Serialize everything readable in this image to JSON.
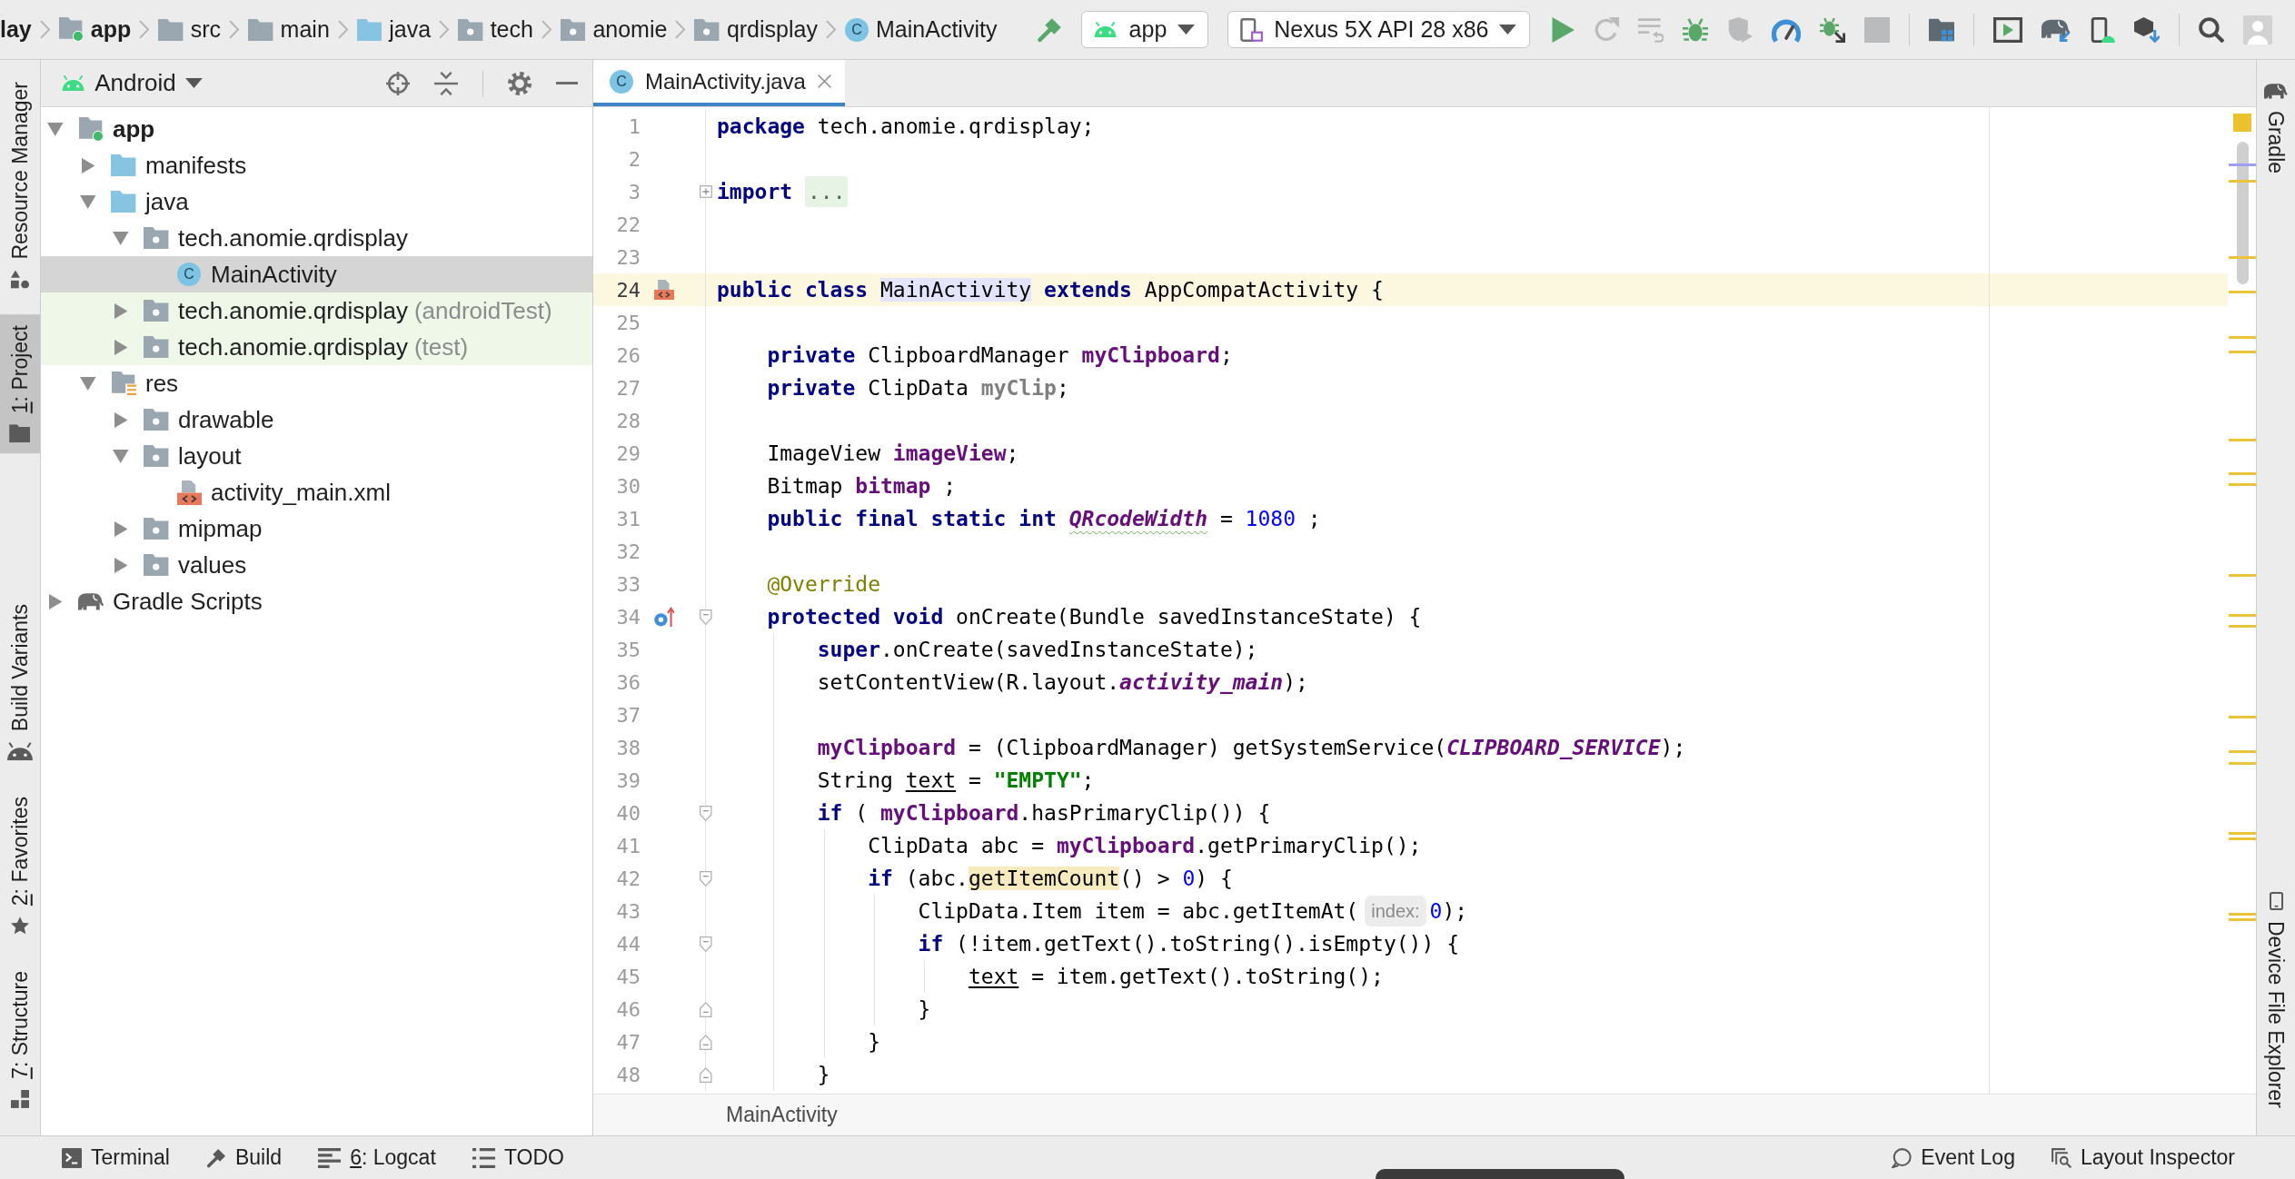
{
  "breadcrumb": [
    {
      "label": "lay",
      "kind": "project"
    },
    {
      "label": "app",
      "kind": "module"
    },
    {
      "label": "src",
      "kind": "folder"
    },
    {
      "label": "main",
      "kind": "folder"
    },
    {
      "label": "java",
      "kind": "source-folder"
    },
    {
      "label": "tech",
      "kind": "package"
    },
    {
      "label": "anomie",
      "kind": "package"
    },
    {
      "label": "qrdisplay",
      "kind": "package"
    },
    {
      "label": "MainActivity",
      "kind": "class",
      "icon_letter": "C"
    }
  ],
  "toolbar": {
    "actions": [
      {
        "kind": "hammer",
        "disabled": false
      },
      {
        "kind": "config-dropdown",
        "label": "app",
        "disabled": false
      },
      {
        "kind": "device-dropdown",
        "label": "Nexus 5X API 28 x86",
        "disabled": false
      },
      {
        "kind": "play",
        "disabled": false
      },
      {
        "kind": "refresh-arrow",
        "disabled": true
      },
      {
        "kind": "lines-arrow",
        "disabled": true
      },
      {
        "kind": "bug",
        "disabled": false
      },
      {
        "kind": "shield-play",
        "disabled": true
      },
      {
        "kind": "gauge",
        "disabled": false
      },
      {
        "kind": "bug-arrow",
        "disabled": false
      },
      {
        "kind": "stop",
        "disabled": true
      },
      {
        "kind": "separator"
      },
      {
        "kind": "folder-grid",
        "disabled": false
      },
      {
        "kind": "separator"
      },
      {
        "kind": "screen-play",
        "disabled": false
      },
      {
        "kind": "elephant-arrow",
        "disabled": false
      },
      {
        "kind": "phone-android",
        "disabled": false
      },
      {
        "kind": "box-arrow",
        "disabled": false
      },
      {
        "kind": "separator"
      },
      {
        "kind": "search",
        "disabled": false
      },
      {
        "kind": "avatar",
        "disabled": false
      }
    ]
  },
  "left_strip": {
    "top": [
      {
        "label": "Resource Manager",
        "kind": "shapes",
        "mnemonic": false,
        "selected": false
      },
      {
        "label": "1: Project",
        "kind": "folder",
        "mnemonic": true,
        "selected": true
      }
    ],
    "bottom": [
      {
        "label": "Build Variants",
        "kind": "android",
        "mnemonic": false,
        "selected": false
      },
      {
        "label": "2: Favorites",
        "kind": "star",
        "mnemonic": true,
        "selected": false
      },
      {
        "label": "7: Structure",
        "kind": "structure",
        "mnemonic": true,
        "selected": false
      }
    ]
  },
  "project_panel": {
    "view": "Android",
    "tools": [
      {
        "kind": "crosshair"
      },
      {
        "kind": "collapse"
      },
      {
        "kind": "separator"
      },
      {
        "kind": "gear"
      },
      {
        "kind": "minimize"
      }
    ],
    "tree": [
      {
        "label": "app",
        "kind": "module",
        "expanded": true,
        "selected": false,
        "test_source": false,
        "children": [
          {
            "label": "manifests",
            "kind": "source-folder",
            "expanded": false,
            "selected": false,
            "test_source": false
          },
          {
            "label": "java",
            "kind": "source-folder",
            "expanded": true,
            "selected": false,
            "test_source": false,
            "children": [
              {
                "label": "tech.anomie.qrdisplay",
                "kind": "package",
                "expanded": true,
                "selected": false,
                "test_source": false,
                "children": [
                  {
                    "label": "MainActivity",
                    "kind": "class",
                    "icon_letter": "C",
                    "selected": true,
                    "test_source": false
                  }
                ]
              },
              {
                "label": "tech.anomie.qrdisplay",
                "suffix": "(androidTest)",
                "kind": "package",
                "expanded": false,
                "selected": false,
                "test_source": true
              },
              {
                "label": "tech.anomie.qrdisplay",
                "suffix": "(test)",
                "kind": "package",
                "expanded": false,
                "selected": false,
                "test_source": true
              }
            ]
          },
          {
            "label": "res",
            "kind": "res-folder",
            "expanded": true,
            "selected": false,
            "test_source": false,
            "children": [
              {
                "label": "drawable",
                "kind": "package",
                "expanded": false,
                "selected": false,
                "test_source": false
              },
              {
                "label": "layout",
                "kind": "package",
                "expanded": true,
                "selected": false,
                "test_source": false,
                "children": [
                  {
                    "label": "activity_main.xml",
                    "kind": "xml",
                    "selected": false,
                    "test_source": false
                  }
                ]
              },
              {
                "label": "mipmap",
                "kind": "package",
                "expanded": false,
                "selected": false,
                "test_source": false
              },
              {
                "label": "values",
                "kind": "package",
                "expanded": false,
                "selected": false,
                "test_source": false
              }
            ]
          }
        ]
      },
      {
        "label": "Gradle Scripts",
        "kind": "gradle",
        "expanded": false,
        "selected": false,
        "test_source": false
      }
    ]
  },
  "editor": {
    "tabs": [
      {
        "label": "MainActivity.java",
        "icon_letter": "C",
        "selected": true
      }
    ],
    "lines": [
      {
        "number": "1",
        "current": false,
        "tokens": [
          {
            "text": "package",
            "kind": "keyword"
          },
          {
            "text": " tech.anomie.qrdisplay;"
          }
        ]
      },
      {
        "number": "2",
        "current": false
      },
      {
        "number": "3",
        "current": false,
        "gutter": [
          {
            "kind": "fold-collapsed"
          }
        ],
        "tokens": [
          {
            "text": "import",
            "kind": "keyword"
          },
          {
            "text": "...",
            "kind": "fold"
          }
        ]
      },
      {
        "number": "22",
        "current": false
      },
      {
        "number": "23",
        "current": false
      },
      {
        "number": "24",
        "current": true,
        "gutter": [
          {
            "kind": "layout-marker"
          }
        ],
        "tokens": [
          {
            "text": "public class ",
            "kind": "keyword"
          },
          {
            "text": "MainActivity",
            "kind": "usage"
          },
          {
            "text": " extends",
            "kind": "keyword"
          },
          {
            "text": " AppCompatActivity {"
          }
        ]
      },
      {
        "number": "25",
        "current": false
      },
      {
        "number": "26",
        "current": false,
        "tokens": [
          {
            "text": "    private",
            "kind": "keyword"
          },
          {
            "text": " ClipboardManager "
          },
          {
            "text": "myClipboard",
            "kind": "field"
          },
          {
            "text": ";"
          }
        ]
      },
      {
        "number": "27",
        "current": false,
        "tokens": [
          {
            "text": "    private",
            "kind": "keyword"
          },
          {
            "text": " ClipData "
          },
          {
            "text": "myClip",
            "kind": "unused-field"
          },
          {
            "text": ";"
          }
        ]
      },
      {
        "number": "28",
        "current": false
      },
      {
        "number": "29",
        "current": false,
        "tokens": [
          {
            "text": "    ImageView "
          },
          {
            "text": "imageView",
            "kind": "field"
          },
          {
            "text": ";"
          }
        ]
      },
      {
        "number": "30",
        "current": false,
        "tokens": [
          {
            "text": "    Bitmap "
          },
          {
            "text": "bitmap",
            "kind": "field"
          },
          {
            "text": " ;"
          }
        ]
      },
      {
        "number": "31",
        "current": false,
        "tokens": [
          {
            "text": "    public final static int ",
            "kind": "keyword"
          },
          {
            "text": "QRcodeWidth",
            "kind": "static-field-typo"
          },
          {
            "text": " = "
          },
          {
            "text": "1080",
            "kind": "number"
          },
          {
            "text": " ;"
          }
        ]
      },
      {
        "number": "32",
        "current": false
      },
      {
        "number": "33",
        "current": false,
        "tokens": [
          {
            "text": "    @Override",
            "kind": "annotation"
          }
        ]
      },
      {
        "number": "34",
        "current": false,
        "gutter": [
          {
            "kind": "override-marker"
          },
          {
            "kind": "fold-start"
          }
        ],
        "tokens": [
          {
            "text": "    protected void",
            "kind": "keyword"
          },
          {
            "text": " onCreate(Bundle savedInstanceState) {"
          }
        ]
      },
      {
        "number": "35",
        "current": false,
        "tokens": [
          {
            "text": "        super",
            "kind": "keyword"
          },
          {
            "text": ".onCreate(savedInstanceState);"
          }
        ]
      },
      {
        "number": "36",
        "current": false,
        "tokens": [
          {
            "text": "        setContentView(R.layout."
          },
          {
            "text": "activity_main",
            "kind": "static-field"
          },
          {
            "text": ");"
          }
        ]
      },
      {
        "number": "37",
        "current": false
      },
      {
        "number": "38",
        "current": false,
        "tokens": [
          {
            "text": "        myClipboard",
            "kind": "field"
          },
          {
            "text": " = (ClipboardManager) getSystemService("
          },
          {
            "text": "CLIPBOARD_SERVICE",
            "kind": "static-field"
          },
          {
            "text": ");"
          }
        ]
      },
      {
        "number": "39",
        "current": false,
        "tokens": [
          {
            "text": "        String "
          },
          {
            "text": "text",
            "kind": "reassigned"
          },
          {
            "text": " = "
          },
          {
            "text": "\"EMPTY\"",
            "kind": "string"
          },
          {
            "text": ";"
          }
        ]
      },
      {
        "number": "40",
        "current": false,
        "gutter": [
          {
            "kind": "fold-start"
          }
        ],
        "tokens": [
          {
            "text": "        if",
            "kind": "keyword"
          },
          {
            "text": " ( "
          },
          {
            "text": "myClipboard",
            "kind": "field"
          },
          {
            "text": ".hasPrimaryClip()) {"
          }
        ]
      },
      {
        "number": "41",
        "current": false,
        "tokens": [
          {
            "text": "            ClipData abc = "
          },
          {
            "text": "myClipboard",
            "kind": "field"
          },
          {
            "text": ".getPrimaryClip();"
          }
        ]
      },
      {
        "number": "42",
        "current": false,
        "gutter": [
          {
            "kind": "fold-start"
          }
        ],
        "tokens": [
          {
            "text": "            if",
            "kind": "keyword"
          },
          {
            "text": " (abc."
          },
          {
            "text": "getItemCount",
            "kind": "highlight"
          },
          {
            "text": "() > "
          },
          {
            "text": "0",
            "kind": "number"
          },
          {
            "text": ") {"
          }
        ]
      },
      {
        "number": "43",
        "current": false,
        "tokens": [
          {
            "text": "                ClipData.Item item = abc.getItemAt("
          },
          {
            "text": "index:",
            "kind": "hint"
          },
          {
            "text": "0",
            "kind": "number"
          },
          {
            "text": ");"
          }
        ]
      },
      {
        "number": "44",
        "current": false,
        "gutter": [
          {
            "kind": "fold-start"
          }
        ],
        "tokens": [
          {
            "text": "                if",
            "kind": "keyword"
          },
          {
            "text": " (!item.getText().toString().isEmpty()) {"
          }
        ]
      },
      {
        "number": "45",
        "current": false,
        "tokens": [
          {
            "text": "                    text",
            "kind": "reassigned"
          },
          {
            "text": " = item.getText().toString();"
          }
        ]
      },
      {
        "number": "46",
        "current": false,
        "gutter": [
          {
            "kind": "fold-end"
          }
        ],
        "tokens": [
          {
            "text": "                }"
          }
        ]
      },
      {
        "number": "47",
        "current": false,
        "gutter": [
          {
            "kind": "fold-end"
          }
        ],
        "tokens": [
          {
            "text": "            }"
          }
        ]
      },
      {
        "number": "48",
        "current": false,
        "gutter": [
          {
            "kind": "fold-end"
          }
        ],
        "tokens": [
          {
            "text": "        }"
          }
        ]
      }
    ],
    "breadcrumb": [
      {
        "label": "MainActivity"
      }
    ]
  },
  "right_strip": {
    "top": [
      {
        "label": "Gradle",
        "kind": "elephant",
        "mnemonic": false,
        "selected": false
      }
    ],
    "bottom": [
      {
        "label": "Device File Explorer",
        "kind": "phone",
        "mnemonic": false,
        "selected": false
      }
    ]
  },
  "bottom_bar": {
    "left": [
      {
        "label": "Terminal",
        "kind": "terminal",
        "mnemonic": false,
        "selected": false
      },
      {
        "label": "Build",
        "kind": "hammer",
        "mnemonic": false,
        "selected": false
      },
      {
        "label": "6: Logcat",
        "kind": "lines",
        "mnemonic": true,
        "selected": false
      },
      {
        "label": "TODO",
        "kind": "list",
        "mnemonic": false,
        "selected": false
      }
    ],
    "right": [
      {
        "label": "Event Log",
        "kind": "bubble",
        "mnemonic": false,
        "selected": false
      },
      {
        "label": "Layout Inspector",
        "kind": "inspector",
        "mnemonic": false,
        "selected": false
      }
    ]
  }
}
